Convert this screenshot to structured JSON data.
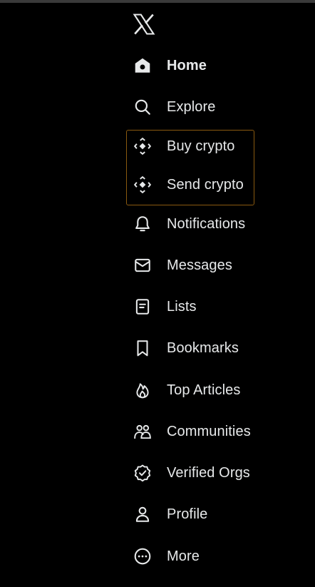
{
  "nav": {
    "home": "Home",
    "explore": "Explore",
    "buy_crypto": "Buy crypto",
    "send_crypto": "Send crypto",
    "notifications": "Notifications",
    "messages": "Messages",
    "lists": "Lists",
    "bookmarks": "Bookmarks",
    "top_articles": "Top Articles",
    "communities": "Communities",
    "verified_orgs": "Verified Orgs",
    "profile": "Profile",
    "more": "More"
  },
  "colors": {
    "background": "#000000",
    "text": "#e7e9ea",
    "highlight_border": "#8a5a10"
  }
}
